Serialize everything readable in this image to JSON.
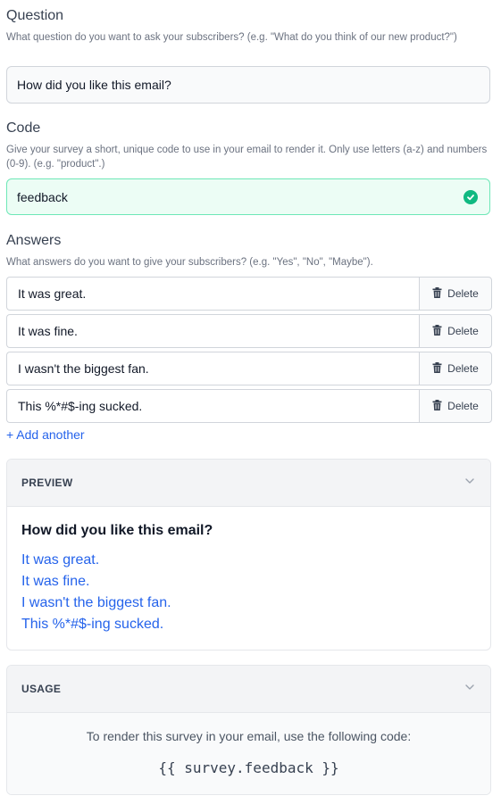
{
  "question": {
    "label": "Question",
    "help": "What question do you want to ask your subscribers? (e.g. \"What do you think of our new product?\")",
    "value": "How did you like this email?"
  },
  "code": {
    "label": "Code",
    "help": "Give your survey a short, unique code to use in your email to render it. Only use letters (a-z) and numbers (0-9). (e.g. \"product\".)",
    "value": "feedback",
    "status_color": "#10b981"
  },
  "answers": {
    "label": "Answers",
    "help": "What answers do you want to give your subscribers? (e.g. \"Yes\", \"No\", \"Maybe\").",
    "items": [
      {
        "value": "It was great.",
        "delete_label": "Delete"
      },
      {
        "value": "It was fine.",
        "delete_label": "Delete"
      },
      {
        "value": "I wasn't the biggest fan.",
        "delete_label": "Delete"
      },
      {
        "value": "This %*#$-ing sucked.",
        "delete_label": "Delete"
      }
    ],
    "add_label": "+ Add another"
  },
  "preview": {
    "title": "PREVIEW",
    "question": "How did you like this email?",
    "answers": [
      "It was great.",
      "It was fine.",
      "I wasn't the biggest fan.",
      "This %*#$-ing sucked."
    ]
  },
  "usage": {
    "title": "USAGE",
    "text": "To render this survey in your email, use the following code:",
    "code": "{{ survey.feedback }}"
  },
  "colors": {
    "accent": "#2563eb",
    "success": "#10b981"
  }
}
